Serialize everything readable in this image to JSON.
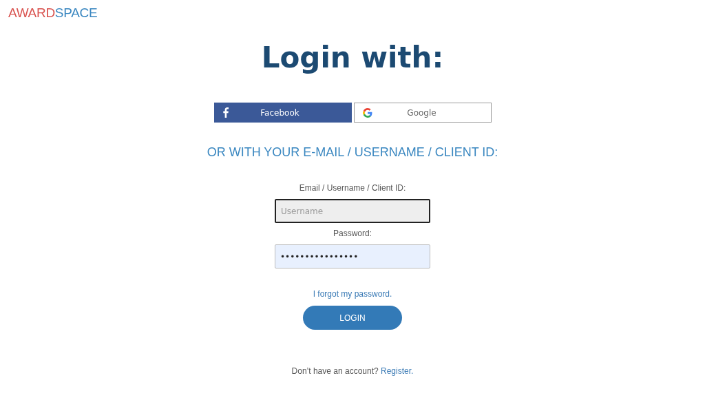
{
  "logo": {
    "part_1": "AWARD",
    "part_2": "SPACE"
  },
  "title": "Login with:",
  "social_buttons": [
    {
      "kind": "facebook",
      "label": "Facebook"
    },
    {
      "kind": "google",
      "label": "Google"
    }
  ],
  "divider_text": "OR WITH YOUR E-MAIL / USERNAME / CLIENT ID:",
  "fields": [
    {
      "label": "Email / Username / Client ID:",
      "placeholder": "Username",
      "focused": true,
      "autofilled": false
    },
    {
      "label": "Password:",
      "value": "••••••••••••••••",
      "focused": false,
      "autofilled": true
    }
  ],
  "forgot_link": "I forgot my password.",
  "login_button": "LOGIN",
  "register": {
    "text": "Don’t have an account?",
    "link": "Register."
  }
}
